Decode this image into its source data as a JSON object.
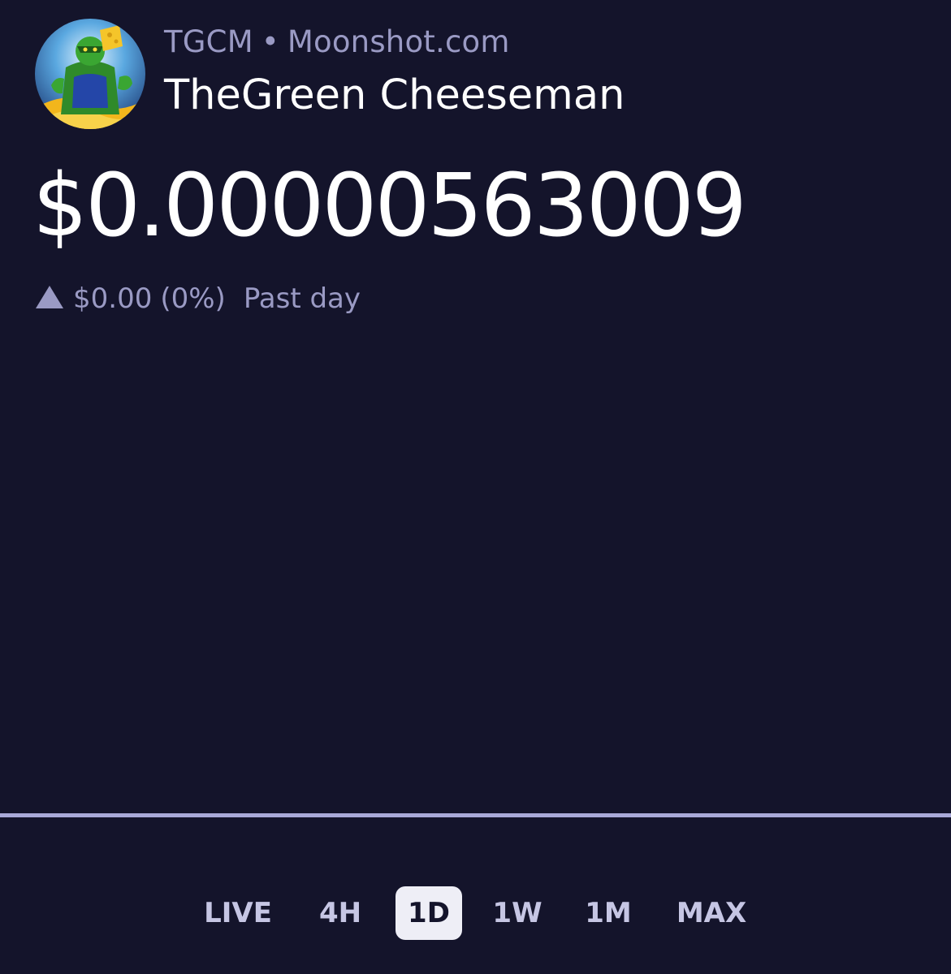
{
  "header": {
    "ticker": "TGCM",
    "separator": "•",
    "source": "Moonshot.com",
    "name": "TheGreen Cheeseman"
  },
  "price": {
    "value": "$0.00000563009",
    "change_amount": "$0.00",
    "change_percent": "(0%)",
    "period": "Past day",
    "direction_icon": "triangle-up-icon"
  },
  "chart": {
    "line_color": "#a9a9d8",
    "background": "#14142b"
  },
  "ranges": {
    "items": [
      "LIVE",
      "4H",
      "1D",
      "1W",
      "1M",
      "MAX"
    ],
    "selected": "1D"
  }
}
